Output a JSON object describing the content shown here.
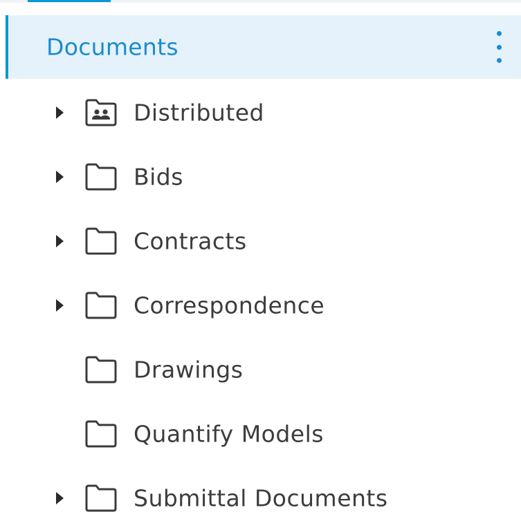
{
  "colors": {
    "accent": "#0696d7",
    "selected_bg": "#e5f2fb",
    "selected_text": "#1a8bd0",
    "text": "#3c3c3c"
  },
  "root": {
    "label": "Documents",
    "menu_icon": "more-vertical-icon"
  },
  "folders": [
    {
      "label": "Distributed",
      "icon": "shared-folder-icon",
      "expandable": true
    },
    {
      "label": "Bids",
      "icon": "folder-icon",
      "expandable": true
    },
    {
      "label": "Contracts",
      "icon": "folder-icon",
      "expandable": true
    },
    {
      "label": "Correspondence",
      "icon": "folder-icon",
      "expandable": true
    },
    {
      "label": "Drawings",
      "icon": "folder-icon",
      "expandable": false
    },
    {
      "label": "Quantify Models",
      "icon": "folder-icon",
      "expandable": false
    },
    {
      "label": "Submittal Documents",
      "icon": "folder-icon",
      "expandable": true
    }
  ]
}
